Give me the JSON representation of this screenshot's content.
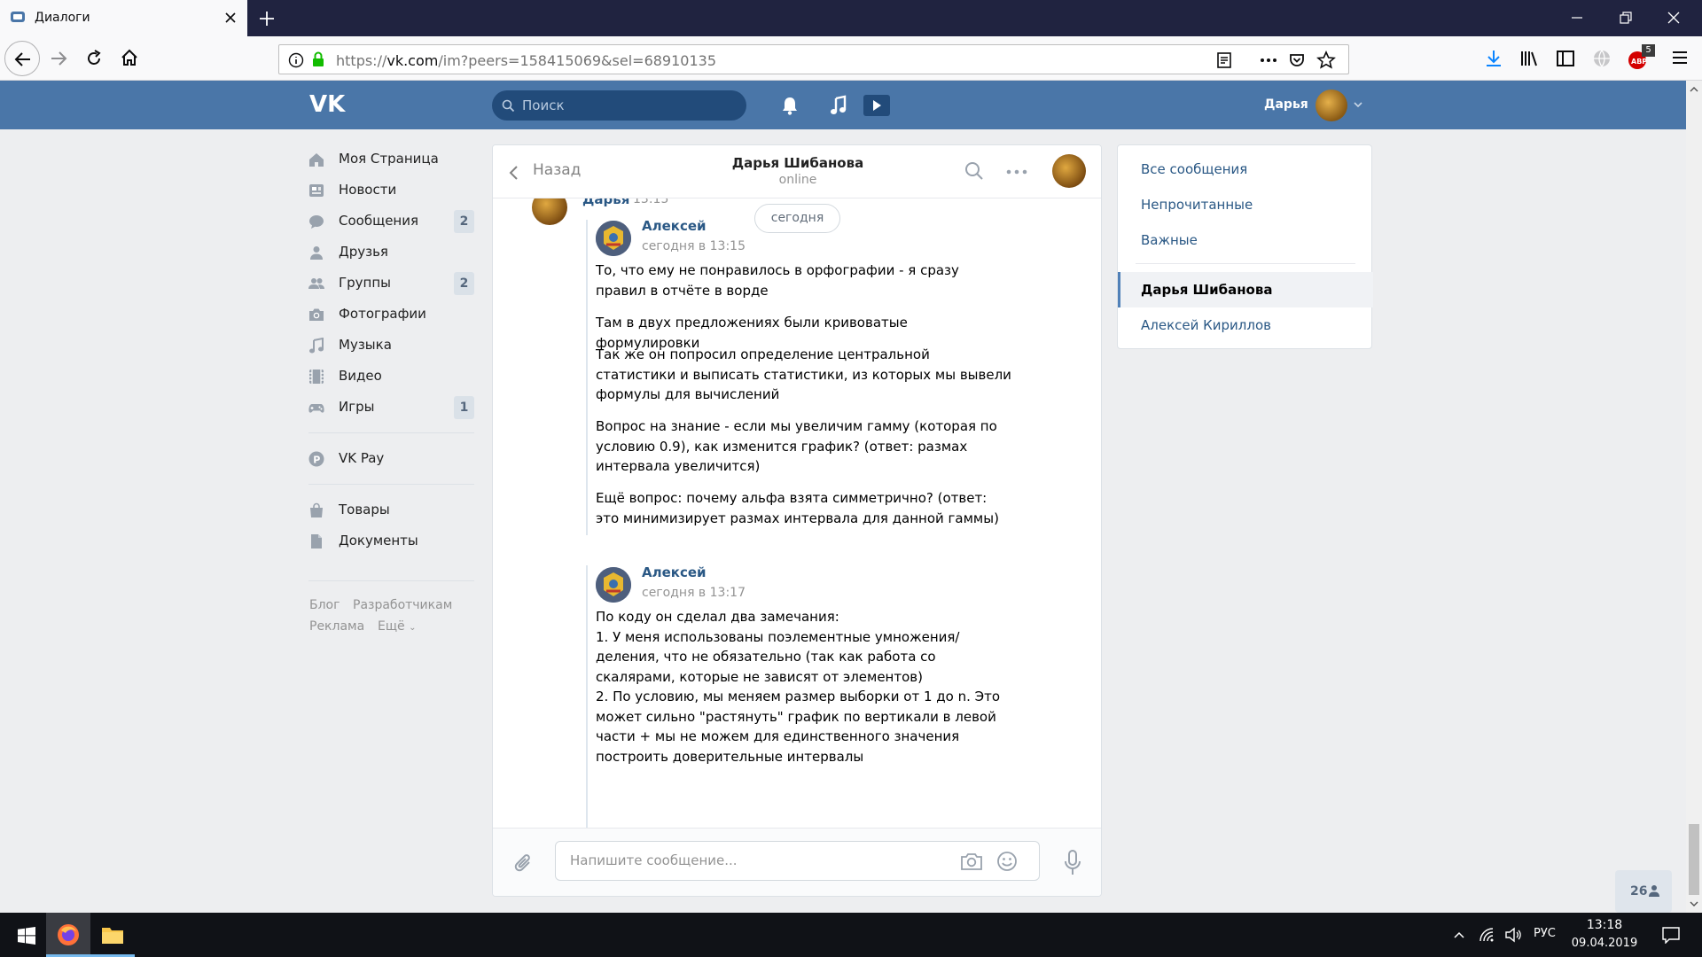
{
  "browser": {
    "tab_title": "Диалоги",
    "url_host": "vk.com",
    "url_prefix": "https://",
    "url_path": "/im?peers=158415069&sel=68910135",
    "extension_badge": "5"
  },
  "header": {
    "search_placeholder": "Поиск",
    "user_name": "Дарья"
  },
  "left_menu": {
    "items": [
      {
        "label": "Моя Страница",
        "icon": "home-icon",
        "badge": ""
      },
      {
        "label": "Новости",
        "icon": "news-icon",
        "badge": ""
      },
      {
        "label": "Сообщения",
        "icon": "messages-icon",
        "badge": "2"
      },
      {
        "label": "Друзья",
        "icon": "friends-icon",
        "badge": ""
      },
      {
        "label": "Группы",
        "icon": "groups-icon",
        "badge": "2"
      },
      {
        "label": "Фотографии",
        "icon": "camera-icon",
        "badge": ""
      },
      {
        "label": "Музыка",
        "icon": "music-icon",
        "badge": ""
      },
      {
        "label": "Видео",
        "icon": "video-icon",
        "badge": ""
      },
      {
        "label": "Игры",
        "icon": "gamepad-icon",
        "badge": "1"
      },
      {
        "label": "VK Pay",
        "icon": "vkpay-icon",
        "badge": ""
      },
      {
        "label": "Товары",
        "icon": "bag-icon",
        "badge": ""
      },
      {
        "label": "Документы",
        "icon": "document-icon",
        "badge": ""
      }
    ],
    "footer": {
      "blog": "Блог",
      "developers": "Разработчикам",
      "ads": "Реклама",
      "more": "Ещё"
    }
  },
  "chat": {
    "back_label": "Назад",
    "title": "Дарья Шибанова",
    "status": "online",
    "date_divider": "сегодня",
    "top_sender": "Дарья",
    "top_time": "13:15",
    "messages": [
      {
        "sender": "Алексей",
        "time": "сегодня в 13:15",
        "paragraphs": [
          "То, что ему не понравилось в орфографии - я сразу правил в отчёте в ворде",
          "Там в двух предложениях были кривоватые формулировки",
          "Так же он попросил определение центральной статистики и выписать статистики, из которых мы вывели формулы для вычислений",
          "Вопрос на знание - если мы увеличим гамму (которая по условию 0.9), как изменится график? (ответ: размах интервала увеличится)",
          "Ещё вопрос: почему альфа взята симметрично? (ответ: это минимизирует размах интервала для данной гаммы)"
        ]
      },
      {
        "sender": "Алексей",
        "time": "сегодня в 13:17",
        "text": "По коду он сделал два замечания:\n1. У меня использованы поэлементные умножения/деления, что не обязательно (так как работа со скалярами, которые не зависят от элементов)\n2. По условию, мы меняем размер выборки от 1 до n. Это может сильно \"растянуть\" график по вертикали в левой части + мы не можем для единственного значения построить доверительные интервалы"
      }
    ],
    "composer_placeholder": "Напишите сообщение..."
  },
  "filters": {
    "items": [
      {
        "label": "Все сообщения"
      },
      {
        "label": "Непрочитанные"
      },
      {
        "label": "Важные"
      }
    ],
    "conversations": [
      {
        "label": "Дарья Шибанова",
        "active": true
      },
      {
        "label": "Алексей Кириллов",
        "active": false
      }
    ]
  },
  "online_count": "26",
  "taskbar": {
    "language": "РУС",
    "time": "13:18",
    "date": "09.04.2019"
  },
  "colors": {
    "vk_blue": "#4a76a8",
    "link": "#2a5885",
    "tabbar": "#202340"
  }
}
